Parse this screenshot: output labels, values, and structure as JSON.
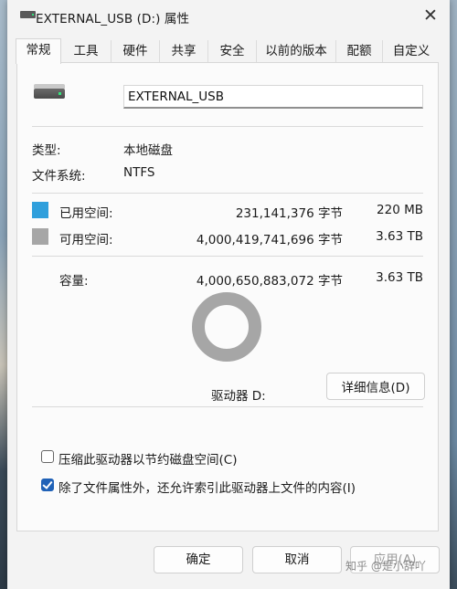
{
  "window": {
    "title": "EXTERNAL_USB (D:) 属性",
    "close_glyph": "✕"
  },
  "tabs": [
    {
      "label": "常规",
      "active": true
    },
    {
      "label": "工具",
      "active": false
    },
    {
      "label": "硬件",
      "active": false
    },
    {
      "label": "共享",
      "active": false
    },
    {
      "label": "安全",
      "active": false
    },
    {
      "label": "以前的版本",
      "active": false
    },
    {
      "label": "配额",
      "active": false
    },
    {
      "label": "自定义",
      "active": false
    }
  ],
  "general": {
    "drive_name": "EXTERNAL_USB",
    "type_label": "类型:",
    "type_value": "本地磁盘",
    "fs_label": "文件系统:",
    "fs_value": "NTFS",
    "used": {
      "label": "已用空间:",
      "bytes": "231,141,376 字节",
      "size": "220 MB",
      "color": "#2f9fdc"
    },
    "free": {
      "label": "可用空间:",
      "bytes": "4,000,419,741,696 字节",
      "size": "3.63 TB",
      "color": "#a6a6a6"
    },
    "capacity": {
      "label": "容量:",
      "bytes": "4,000,650,883,072 字节",
      "size": "3.63 TB"
    },
    "drive_letter": "驱动器 D:",
    "details_button": "详细信息(D)",
    "compress_label": "压缩此驱动器以节约磁盘空间(C)",
    "compress_checked": false,
    "index_label": "除了文件属性外，还允许索引此驱动器上文件的内容(I)",
    "index_checked": true
  },
  "chart_data": {
    "type": "pie",
    "categories": [
      "已用空间",
      "可用空间"
    ],
    "values": [
      231141376,
      4000419741696
    ],
    "colors": [
      "#2f9fdc",
      "#a6a6a6"
    ]
  },
  "footer": {
    "ok": "确定",
    "cancel": "取消",
    "apply": "应用(A)"
  },
  "watermark": "知乎 @是小辞吖"
}
